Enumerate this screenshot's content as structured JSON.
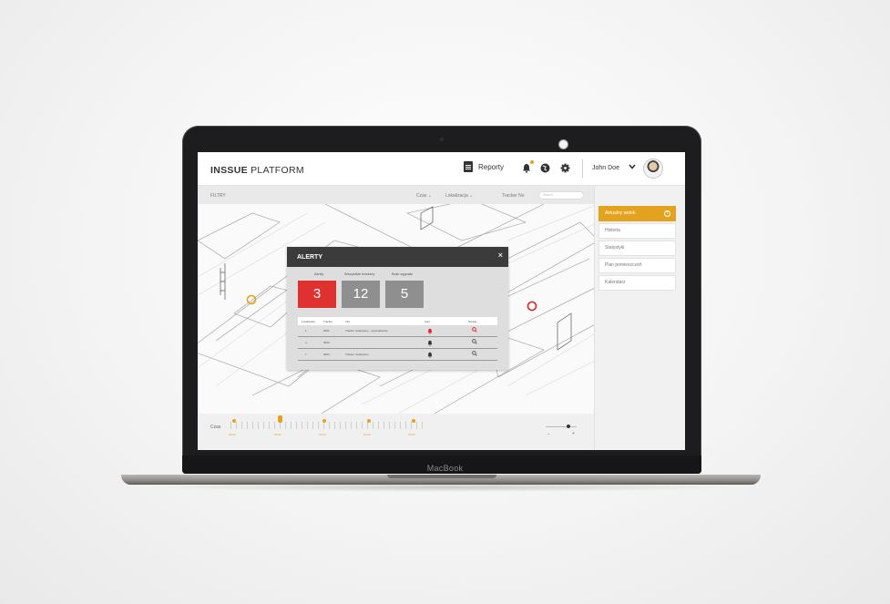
{
  "device": {
    "brand": "MacBook"
  },
  "header": {
    "logo_bold": "INSSUE",
    "logo_rest": "PLATFORM",
    "reports_label": "Reporty",
    "user_name": "John Doe",
    "icons": [
      "document-icon",
      "bell-icon",
      "globe-icon",
      "gear-icon",
      "chevron-down-icon"
    ]
  },
  "filters": {
    "title": "FILTRY",
    "czas": "Czas",
    "lokalizacja": "Lokalizacja",
    "tracker_label": "Tracker No",
    "tracker_placeholder": "Search"
  },
  "side_menu": {
    "items": [
      {
        "label": "Aktualny widok",
        "active": true
      },
      {
        "label": "Historia",
        "active": false
      },
      {
        "label": "Statystyki",
        "active": false
      },
      {
        "label": "Plan pomieszczeń",
        "active": false
      },
      {
        "label": "Kalendarz",
        "active": false
      }
    ]
  },
  "modal": {
    "title": "ALERTY",
    "close": "×",
    "stats": [
      {
        "label": "Alerty",
        "value": "3",
        "color": "#e03131"
      },
      {
        "label": "Wszystkie trackery",
        "value": "12",
        "color": "#8f8f8f"
      },
      {
        "label": "Brak sygnału",
        "value": "5",
        "color": "#8f8f8f"
      }
    ],
    "table": {
      "columns": [
        "Lokalizacja",
        "Tracker",
        "Info",
        "Alert",
        "Szukaj"
      ],
      "rows": [
        {
          "loc": "1",
          "tracker": "0001",
          "info": "Tracker nieaktywny - wyszukiwanie",
          "alert": "red"
        },
        {
          "loc": "4",
          "tracker": "0003",
          "info": "",
          "alert": "dark"
        },
        {
          "loc": "7",
          "tracker": "0004",
          "info": "Tracker nieaktywny",
          "alert": "dark"
        }
      ]
    }
  },
  "timeline": {
    "label": "Czas",
    "times": [
      "06:00",
      "09:00",
      "12:00",
      "15:00",
      "18:00"
    ],
    "zoom_minus": "−",
    "zoom_plus": "+"
  },
  "colors": {
    "accent": "#e3a31e",
    "alert": "#e03131",
    "modal_header": "#3b3b3b"
  }
}
